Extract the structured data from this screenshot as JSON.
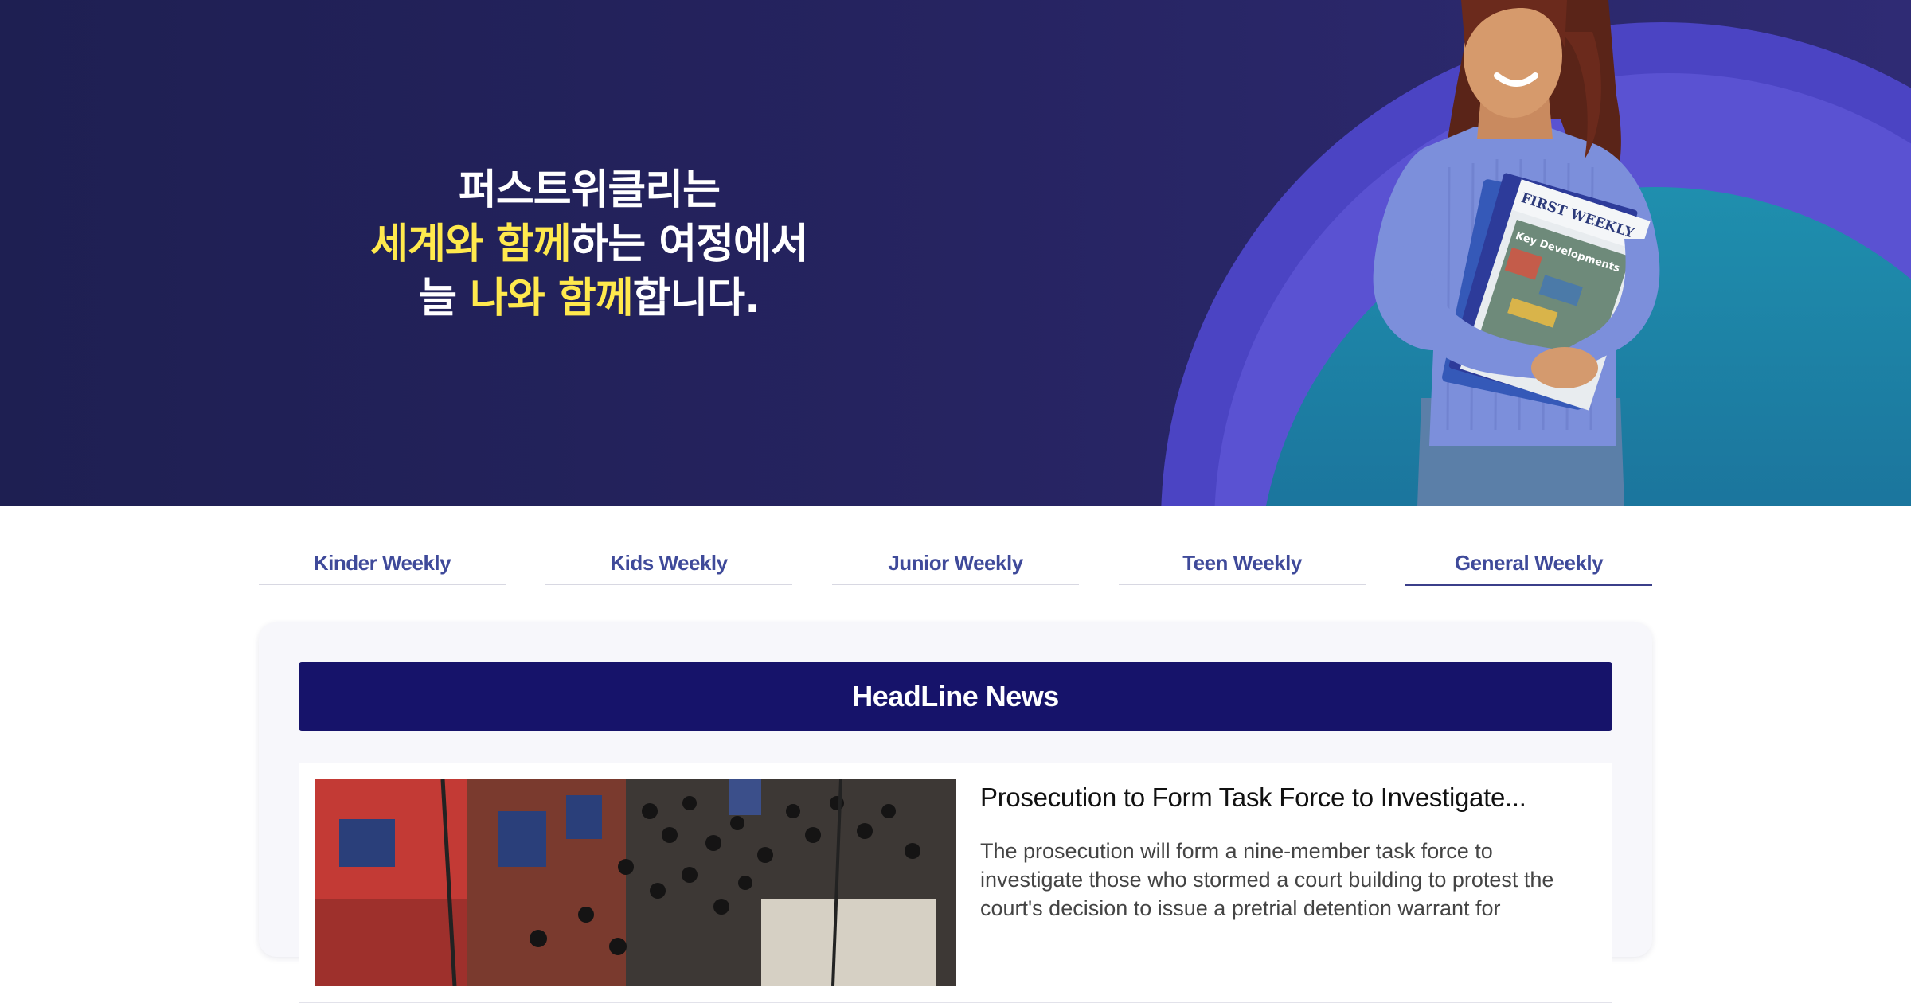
{
  "hero": {
    "line1": "퍼스트위클리는",
    "line2_highlight": "세계와 함께",
    "line2_rest": "하는 여정에서",
    "line3_start": "늘 ",
    "line3_highlight": "나와 함께",
    "line3_end": "합니다.",
    "magazine_brand": "FIRST WEEKLY GENERAL",
    "magazine_headline": "Key Developments in International Trade Agreements"
  },
  "tabs": [
    {
      "label": "Kinder Weekly"
    },
    {
      "label": "Kids Weekly"
    },
    {
      "label": "Junior Weekly"
    },
    {
      "label": "Teen Weekly"
    },
    {
      "label": "General Weekly"
    }
  ],
  "headline_section": {
    "title": "HeadLine News",
    "article": {
      "title": "Prosecution to Form Task Force to Investigate...",
      "summary": "The prosecution will form a nine-member task force to investigate those who stormed a court building to protest the court's decision to issue a pretrial detention warrant for"
    }
  },
  "colors": {
    "hero_bg": "#25235f",
    "highlight": "#ffe94d",
    "tab_text": "#3f4a9a",
    "headline_bar": "#16136a"
  }
}
